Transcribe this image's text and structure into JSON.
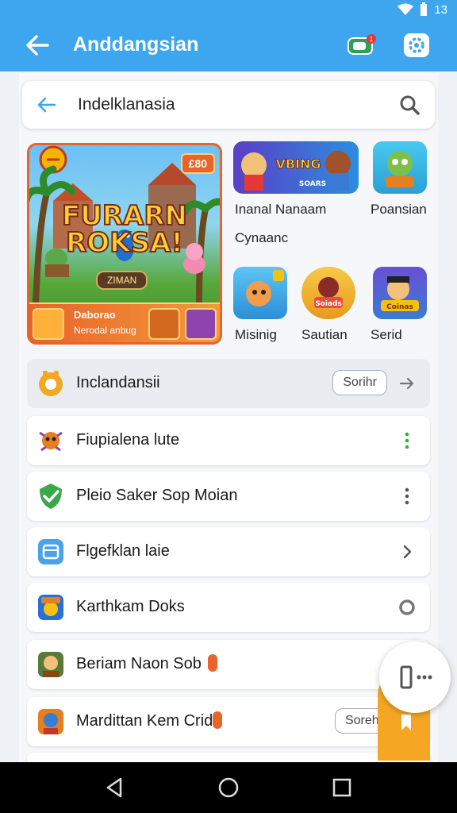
{
  "status": {
    "time": "13"
  },
  "appbar": {
    "title": "Anddangsian",
    "badge_count": "1"
  },
  "search": {
    "text": "Indelklanasia"
  },
  "featured": {
    "tag": "£80",
    "logo_line1": "FURARN",
    "logo_line2": "ROKSA!",
    "sub": "ZIMAN",
    "strip_title": "Daborao",
    "strip_subtitle": "Nerodal anbug"
  },
  "games": [
    {
      "label": "Inanal Nanaam",
      "tile_text": "VBING",
      "tile_sub": "SOARS"
    },
    {
      "label": "Poansian",
      "tile_text": ""
    },
    {
      "label": "Cynaanc",
      "tile_text": ""
    },
    {
      "label": "Misinig",
      "tile_text": ""
    },
    {
      "label": "Sautian",
      "tile_text": "Soiads"
    },
    {
      "label": "Serid",
      "tile_text": "Coinas"
    }
  ],
  "section": {
    "title": "Inclandansii",
    "pill": "Sorihr"
  },
  "rows": [
    {
      "label": "Fiupialena lute",
      "action": "more"
    },
    {
      "label": "Pleio Saker Sop Moian",
      "action": "more"
    },
    {
      "label": "Flgefklan laie",
      "action": "chevron"
    },
    {
      "label": "Karthkam Doks",
      "action": "ring"
    },
    {
      "label": "Beriam Naon Sob",
      "action": "none"
    },
    {
      "label": "Mardittan Kem Crid",
      "action": "none",
      "pill": "Sorehr"
    }
  ],
  "colors": {
    "primary": "#3ea6ee",
    "accent": "#f5a623",
    "alert": "#e8642a",
    "green": "#3aa84a"
  }
}
